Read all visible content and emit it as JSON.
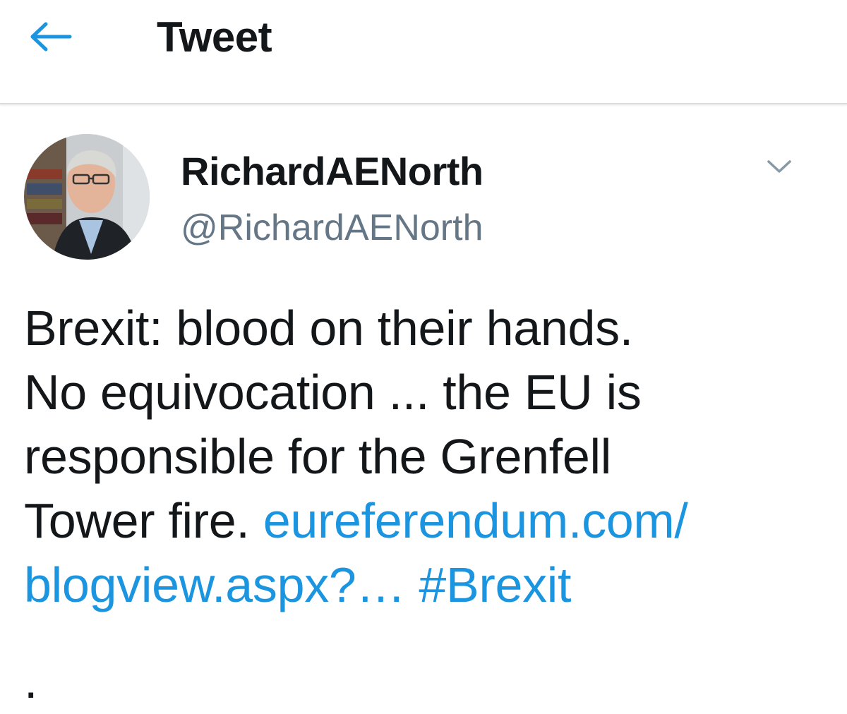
{
  "header": {
    "back_icon": "arrow-left-icon",
    "title": "Tweet"
  },
  "author": {
    "avatar_icon": "avatar-photo",
    "display_name": "RichardAENorth",
    "handle": "@RichardAENorth",
    "more_icon": "chevron-down-icon"
  },
  "tweet": {
    "line1": "Brexit: blood on their hands.",
    "line2": "No equivocation ... the EU is",
    "line3": "responsible for the Grenfell",
    "line4_text": "Tower fire.",
    "line4_link": "eureferendum.com/",
    "line5_link": "blogview.aspx?…",
    "hashtag": "#Brexit",
    "trailing": "."
  },
  "colors": {
    "accent": "#1b95e0",
    "text": "#14171a",
    "secondary": "#657786",
    "divider": "#d9dde0"
  }
}
